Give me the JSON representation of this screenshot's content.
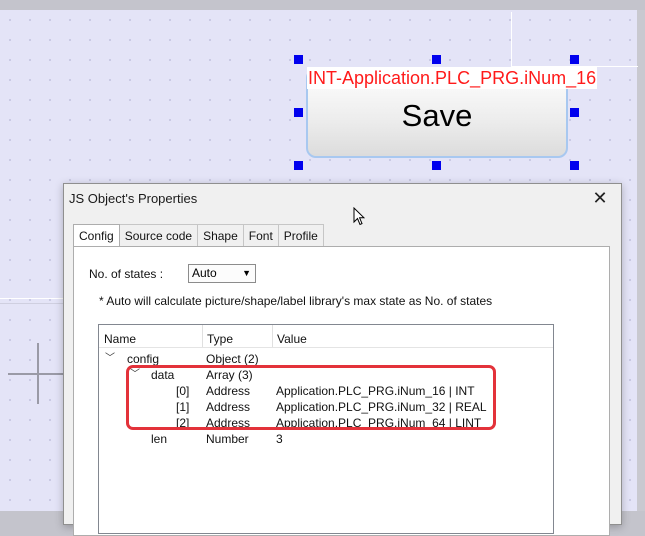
{
  "widget": {
    "variable_label": "INT-Application.PLC_PRG.iNum_16",
    "button_label": "Save"
  },
  "dialog": {
    "title": "JS Object's Properties",
    "close_glyph": "✕",
    "tabs": [
      "Config",
      "Source code",
      "Shape",
      "Font",
      "Profile"
    ],
    "active_tab": "Config",
    "states_label": "No. of states :",
    "states_value": "Auto",
    "note": "* Auto will calculate picture/shape/label library's max state as No. of states",
    "tree": {
      "headers": [
        "Name",
        "Type",
        "Value"
      ],
      "rows": [
        {
          "name": "config",
          "type": "Object (2)",
          "value": "",
          "expanded": true
        },
        {
          "name": "data",
          "type": "Array (3)",
          "value": "",
          "expanded": true
        },
        {
          "name": "[0]",
          "type": "Address",
          "value": "Application.PLC_PRG.iNum_16 | INT"
        },
        {
          "name": "[1]",
          "type": "Address",
          "value": "Application.PLC_PRG.iNum_32 | REAL"
        },
        {
          "name": "[2]",
          "type": "Address",
          "value": "Application.PLC_PRG.iNum_64 | LINT"
        },
        {
          "name": "len",
          "type": "Number",
          "value": "3"
        }
      ]
    }
  },
  "colors": {
    "highlight_border": "#e3323a",
    "selection_handle": "#0000ee",
    "variable_text": "#ff1a1a"
  }
}
